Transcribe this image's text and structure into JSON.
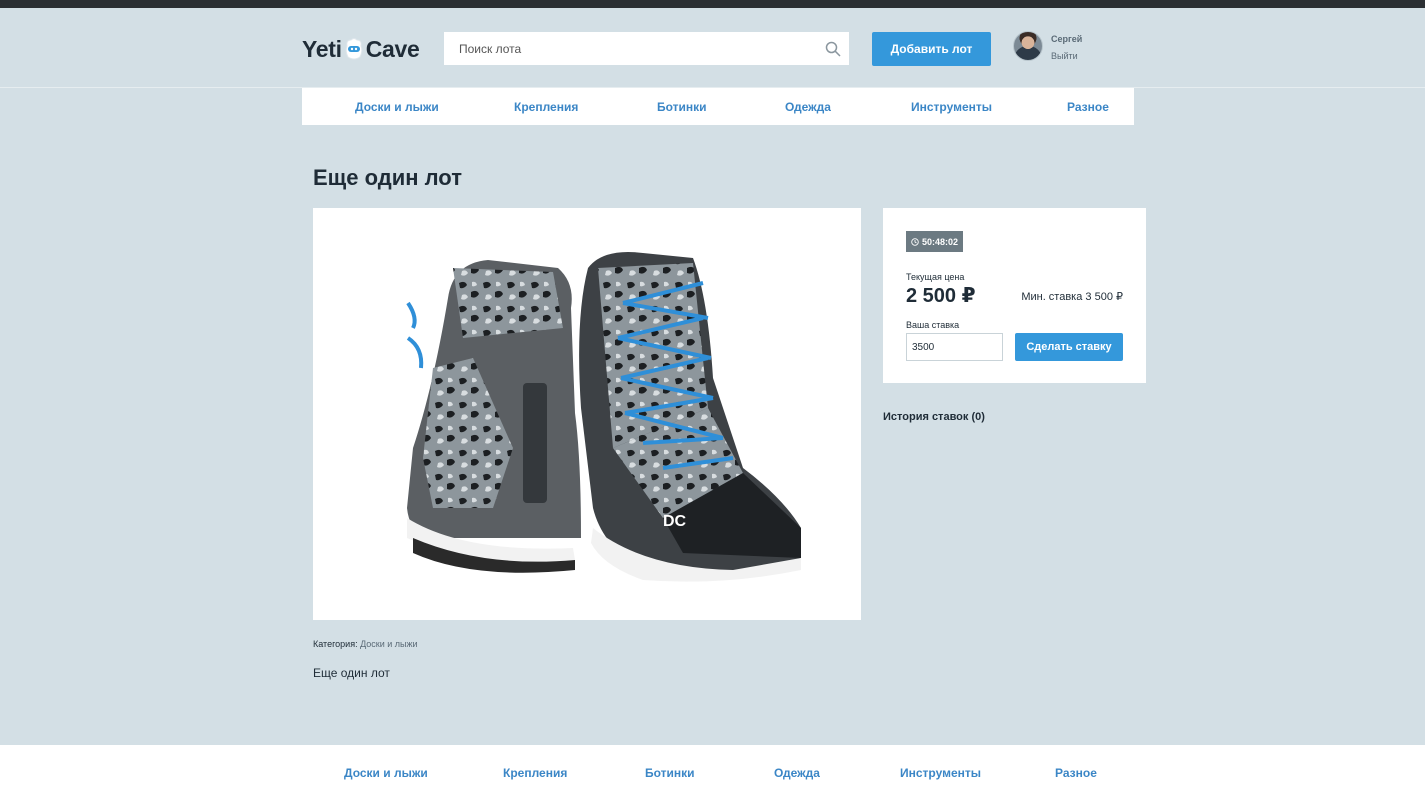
{
  "header": {
    "logo_left": "Yeti",
    "logo_right": "Cave",
    "search_placeholder": "Поиск лота",
    "add_lot_label": "Добавить лот",
    "user_name": "Сергей",
    "logout_label": "Выйти"
  },
  "nav": {
    "items": [
      "Доски и лыжи",
      "Крепления",
      "Ботинки",
      "Одежда",
      "Инструменты",
      "Разное"
    ]
  },
  "lot": {
    "title": "Еще один лот",
    "category_label": "Категория:",
    "category_value": "Доски и лыжи",
    "description": "Еще один лот"
  },
  "bid": {
    "timer": "50:48:02",
    "current_price_label": "Текущая цена",
    "current_price": "2 500 ₽",
    "min_bid": "Мин. ставка 3 500 ₽",
    "your_bid_label": "Ваша ставка",
    "your_bid_value": "3500",
    "submit_label": "Сделать ставку",
    "history_label": "История ставок (0)"
  },
  "footer": {
    "items": [
      "Доски и лыжи",
      "Крепления",
      "Ботинки",
      "Одежда",
      "Инструменты",
      "Разное"
    ]
  },
  "colors": {
    "page_background": "#d3dfe5",
    "accent": "#3498db",
    "link": "#3b86c6",
    "text": "#1f2c37"
  }
}
